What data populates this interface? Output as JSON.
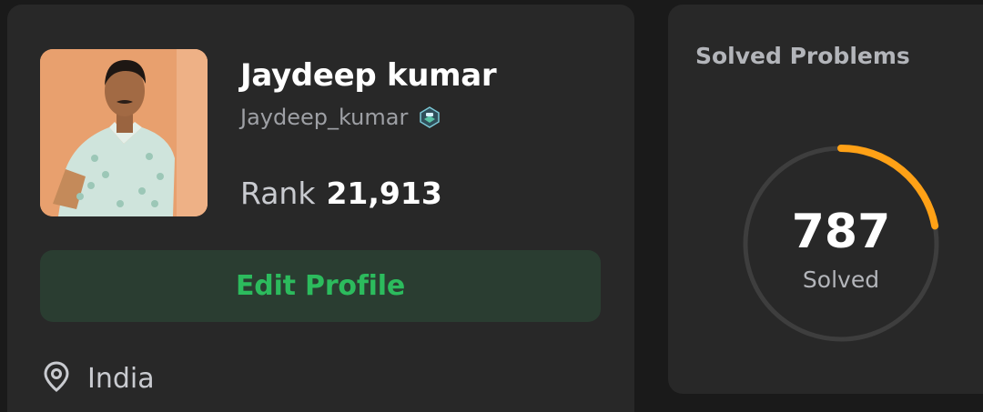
{
  "profile": {
    "name": "Jaydeep kumar",
    "username": "Jaydeep_kumar",
    "rank_label": "Rank",
    "rank_value": "21,913",
    "edit_button_label": "Edit Profile",
    "location": "India",
    "badge_icon": "badge-icon",
    "location_icon": "location-pin-icon"
  },
  "solved": {
    "title": "Solved Problems",
    "count": "787",
    "label": "Solved",
    "progress_fraction": 0.22,
    "ring_track_color": "#3e3e3e",
    "ring_progress_color": "#ffa116"
  },
  "colors": {
    "accent_green": "#2cbb5d",
    "button_bg": "#2a3d31",
    "card_bg": "#282828",
    "page_bg": "#1a1a1a"
  }
}
